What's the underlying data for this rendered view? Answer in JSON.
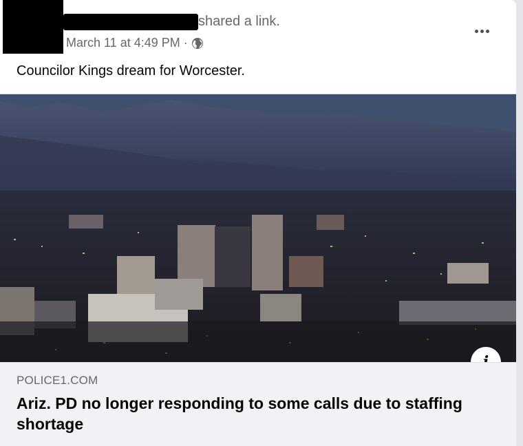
{
  "post": {
    "action_text": "shared a link.",
    "timestamp": "March 11 at 4:49 PM",
    "separator": "·",
    "privacy_icon": "globe-icon",
    "more_icon": "more-options-icon",
    "caption": "Councilor Kings dream for Worcester."
  },
  "link_preview": {
    "image_description_icon": "city-skyline-photo",
    "info_icon": "info-icon",
    "info_glyph": "i",
    "domain": "POLICE1.COM",
    "headline": "Ariz. PD no longer responding to some calls due to staffing shortage"
  },
  "colors": {
    "secondary_text": "#65676b",
    "primary_text": "#050505",
    "footer_bg": "#f0f2f5"
  }
}
